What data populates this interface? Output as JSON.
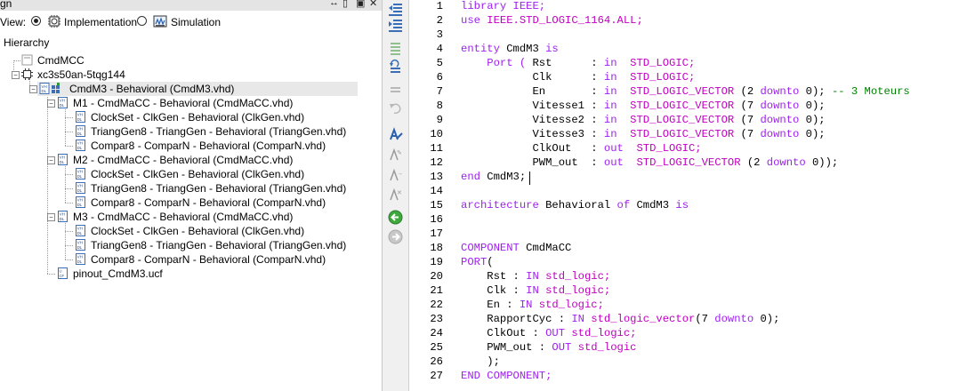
{
  "panel": {
    "title": "gn",
    "view_label": "View:",
    "view_options": [
      "Implementation",
      "Simulation"
    ],
    "hierarchy_label": "Hierarchy"
  },
  "tree": [
    {
      "label": "CmdMCC"
    },
    {
      "label": "xc3s50an-5tqg144"
    },
    {
      "label": "CmdM3 - Behavioral (CmdM3.vhd)"
    },
    {
      "label": "M1 - CmdMaCC - Behavioral (CmdMaCC.vhd)"
    },
    {
      "label": "ClockSet - ClkGen - Behavioral (ClkGen.vhd)"
    },
    {
      "label": "TriangGen8 - TriangGen - Behavioral (TriangGen.vhd)"
    },
    {
      "label": "Compar8 - ComparN - Behavioral (ComparN.vhd)"
    },
    {
      "label": "M2 - CmdMaCC - Behavioral (CmdMaCC.vhd)"
    },
    {
      "label": "ClockSet - ClkGen - Behavioral (ClkGen.vhd)"
    },
    {
      "label": "TriangGen8 - TriangGen - Behavioral (TriangGen.vhd)"
    },
    {
      "label": "Compar8 - ComparN - Behavioral (ComparN.vhd)"
    },
    {
      "label": "M3 - CmdMaCC - Behavioral (CmdMaCC.vhd)"
    },
    {
      "label": "ClockSet - ClkGen - Behavioral (ClkGen.vhd)"
    },
    {
      "label": "TriangGen8 - TriangGen - Behavioral (TriangGen.vhd)"
    },
    {
      "label": "Compar8 - ComparN - Behavioral (ComparN.vhd)"
    },
    {
      "label": "pinout_CmdM3.ucf"
    }
  ],
  "code": [
    [
      {
        "t": "library IEEE;",
        "c": "kw"
      }
    ],
    [
      {
        "t": "use ",
        "c": "kw"
      },
      {
        "t": "IEEE.STD_LOGIC_1164.ALL;",
        "c": "tp"
      }
    ],
    [],
    [
      {
        "t": "entity ",
        "c": "kw"
      },
      {
        "t": "CmdM3 ",
        "c": "pl"
      },
      {
        "t": "is",
        "c": "kw"
      }
    ],
    [
      {
        "t": "    Port ( ",
        "c": "kw"
      },
      {
        "t": "Rst      : ",
        "c": "pl"
      },
      {
        "t": "in  ",
        "c": "kw"
      },
      {
        "t": "STD_LOGIC;",
        "c": "tp"
      }
    ],
    [
      {
        "t": "           Clk      : ",
        "c": "pl"
      },
      {
        "t": "in  ",
        "c": "kw"
      },
      {
        "t": "STD_LOGIC;",
        "c": "tp"
      }
    ],
    [
      {
        "t": "           En       : ",
        "c": "pl"
      },
      {
        "t": "in  ",
        "c": "kw"
      },
      {
        "t": "STD_LOGIC_VECTOR ",
        "c": "tp"
      },
      {
        "t": "(2 ",
        "c": "pl"
      },
      {
        "t": "downto ",
        "c": "kw"
      },
      {
        "t": "0); ",
        "c": "pl"
      },
      {
        "t": "-- 3 Moteurs",
        "c": "cm"
      }
    ],
    [
      {
        "t": "           Vitesse1 : ",
        "c": "pl"
      },
      {
        "t": "in  ",
        "c": "kw"
      },
      {
        "t": "STD_LOGIC_VECTOR ",
        "c": "tp"
      },
      {
        "t": "(7 ",
        "c": "pl"
      },
      {
        "t": "downto ",
        "c": "kw"
      },
      {
        "t": "0);",
        "c": "pl"
      }
    ],
    [
      {
        "t": "           Vitesse2 : ",
        "c": "pl"
      },
      {
        "t": "in  ",
        "c": "kw"
      },
      {
        "t": "STD_LOGIC_VECTOR ",
        "c": "tp"
      },
      {
        "t": "(7 ",
        "c": "pl"
      },
      {
        "t": "downto ",
        "c": "kw"
      },
      {
        "t": "0);",
        "c": "pl"
      }
    ],
    [
      {
        "t": "           Vitesse3 : ",
        "c": "pl"
      },
      {
        "t": "in  ",
        "c": "kw"
      },
      {
        "t": "STD_LOGIC_VECTOR ",
        "c": "tp"
      },
      {
        "t": "(7 ",
        "c": "pl"
      },
      {
        "t": "downto ",
        "c": "kw"
      },
      {
        "t": "0);",
        "c": "pl"
      }
    ],
    [
      {
        "t": "           ClkOut   : ",
        "c": "pl"
      },
      {
        "t": "out  ",
        "c": "kw"
      },
      {
        "t": "STD_LOGIC;",
        "c": "tp"
      }
    ],
    [
      {
        "t": "           PWM_out  : ",
        "c": "pl"
      },
      {
        "t": "out  ",
        "c": "kw"
      },
      {
        "t": "STD_LOGIC_VECTOR ",
        "c": "tp"
      },
      {
        "t": "(2 ",
        "c": "pl"
      },
      {
        "t": "downto ",
        "c": "kw"
      },
      {
        "t": "0));",
        "c": "pl"
      }
    ],
    [
      {
        "t": "end ",
        "c": "kw"
      },
      {
        "t": "CmdM3;",
        "c": "pl"
      }
    ],
    [],
    [
      {
        "t": "architecture ",
        "c": "kw"
      },
      {
        "t": "Behavioral ",
        "c": "pl"
      },
      {
        "t": "of ",
        "c": "kw"
      },
      {
        "t": "CmdM3 ",
        "c": "pl"
      },
      {
        "t": "is",
        "c": "kw"
      }
    ],
    [],
    [],
    [
      {
        "t": "COMPONENT ",
        "c": "kw"
      },
      {
        "t": "CmdMaCC",
        "c": "pl"
      }
    ],
    [
      {
        "t": "PORT",
        "c": "kw"
      },
      {
        "t": "(",
        "c": "pl"
      }
    ],
    [
      {
        "t": "    Rst : ",
        "c": "pl"
      },
      {
        "t": "IN ",
        "c": "kw"
      },
      {
        "t": "std_logic;",
        "c": "tp"
      }
    ],
    [
      {
        "t": "    Clk : ",
        "c": "pl"
      },
      {
        "t": "IN ",
        "c": "kw"
      },
      {
        "t": "std_logic;",
        "c": "tp"
      }
    ],
    [
      {
        "t": "    En : ",
        "c": "pl"
      },
      {
        "t": "IN ",
        "c": "kw"
      },
      {
        "t": "std_logic;",
        "c": "tp"
      }
    ],
    [
      {
        "t": "    RapportCyc : ",
        "c": "pl"
      },
      {
        "t": "IN ",
        "c": "kw"
      },
      {
        "t": "std_logic_vector",
        "c": "tp"
      },
      {
        "t": "(7 ",
        "c": "pl"
      },
      {
        "t": "downto ",
        "c": "kw"
      },
      {
        "t": "0);",
        "c": "pl"
      }
    ],
    [
      {
        "t": "    ClkOut : ",
        "c": "pl"
      },
      {
        "t": "OUT ",
        "c": "kw"
      },
      {
        "t": "std_logic;",
        "c": "tp"
      }
    ],
    [
      {
        "t": "    PWM_out : ",
        "c": "pl"
      },
      {
        "t": "OUT ",
        "c": "kw"
      },
      {
        "t": "std_logic",
        "c": "tp"
      }
    ],
    [
      {
        "t": "    );",
        "c": "pl"
      }
    ],
    [
      {
        "t": "END COMPONENT;",
        "c": "kw"
      }
    ]
  ],
  "colors": {
    "keyword": "#a020f0",
    "type": "#c000c0",
    "comment": "#008000"
  }
}
